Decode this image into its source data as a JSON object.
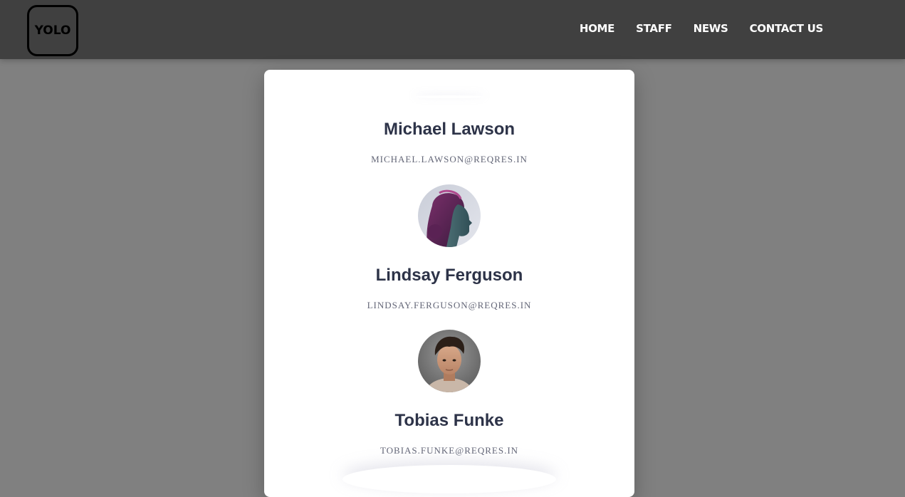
{
  "header": {
    "logo_text": "YOLO",
    "nav": [
      "HOME",
      "STAFF",
      "NEWS",
      "CONTACT US"
    ]
  },
  "staff": [
    {
      "name": "Michael Lawson",
      "email": "MICHAEL.LAWSON@REQRES.IN"
    },
    {
      "name": "Lindsay Ferguson",
      "email": "LINDSAY.FERGUSON@REQRES.IN",
      "avatar": "woman-profile-portrait"
    },
    {
      "name": "Tobias Funke",
      "email": "TOBIAS.FUNKE@REQRES.IN",
      "avatar": "man-portrait"
    }
  ],
  "colors": {
    "background": "#808080",
    "navbar": "#404040",
    "card": "#ffffff",
    "name_text": "#2d3348",
    "email_text": "#636677"
  }
}
